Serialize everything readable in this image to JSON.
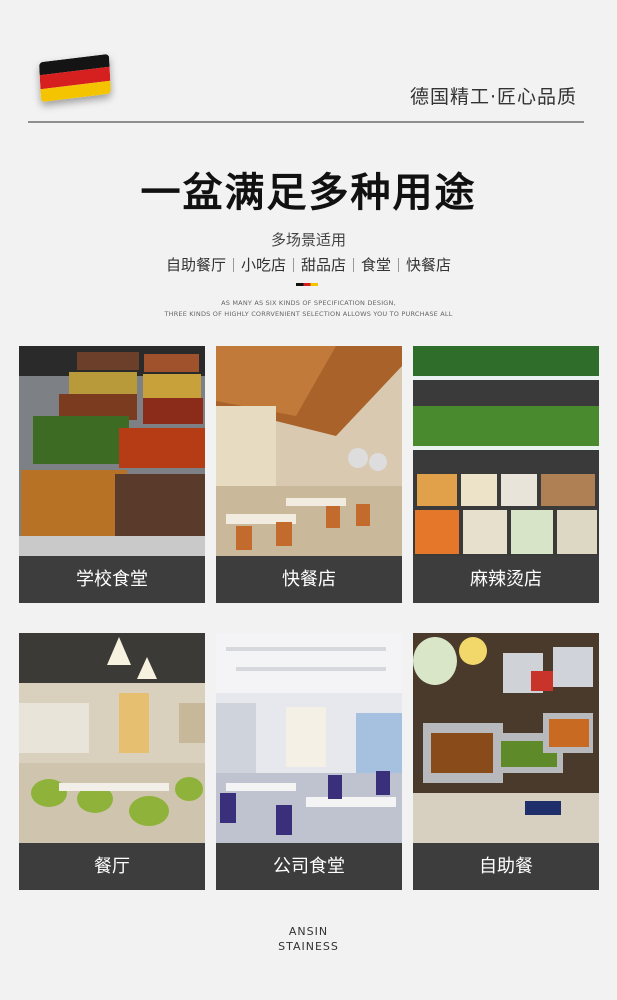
{
  "header": {
    "tagline": "德国精工·匠心品质"
  },
  "main": {
    "title": "一盆满足多种用途",
    "subtitle": "多场景适用",
    "scenes": [
      "自助餐厅",
      "小吃店",
      "甜品店",
      "食堂",
      "快餐店"
    ],
    "english": [
      "AS MANY AS SIX KINDS OF SPECIFICATION DESIGN,",
      "THREE KINDS OF HIGHLY CORRVENIENT SELECTION ALLOWS YOU TO PURCHASE ALL"
    ]
  },
  "cards": [
    {
      "label": "学校食堂"
    },
    {
      "label": "快餐店"
    },
    {
      "label": "麻辣烫店"
    },
    {
      "label": "餐厅"
    },
    {
      "label": "公司食堂"
    },
    {
      "label": "自助餐"
    }
  ],
  "footer": {
    "line1": "ANSIN",
    "line2": "STAINESS"
  },
  "colors": {
    "label_bg": "#3d3d3d",
    "flag_black": "#141414",
    "flag_red": "#d61f1f",
    "flag_gold": "#f5c400"
  }
}
